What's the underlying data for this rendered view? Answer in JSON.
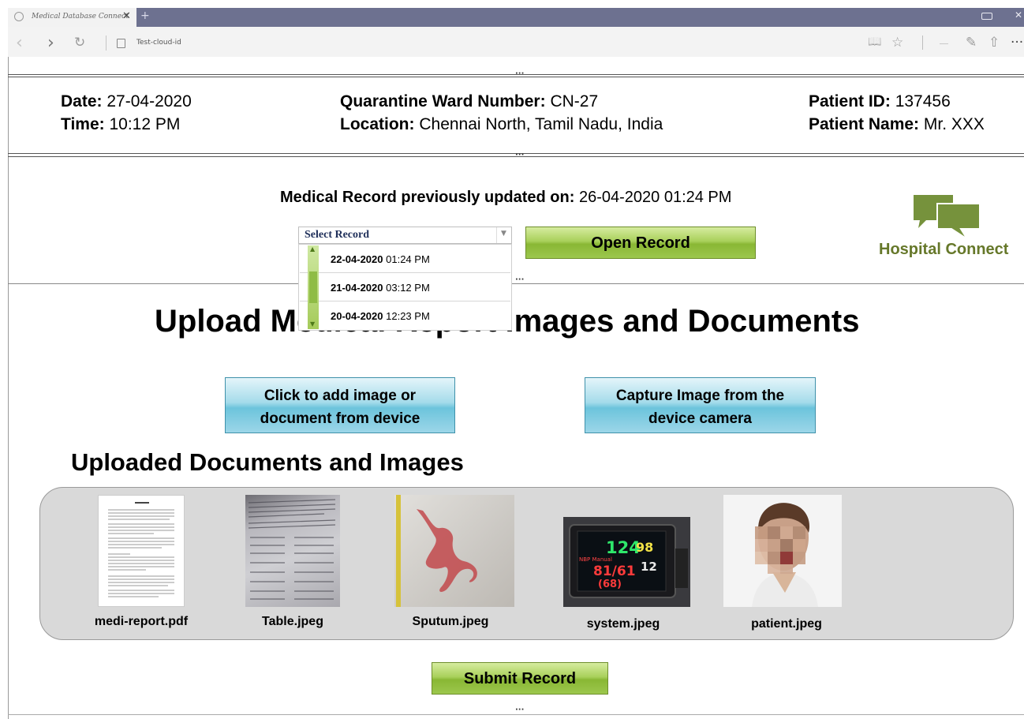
{
  "browser": {
    "tab_title": "Medical Database Connect",
    "tab_close": "✕",
    "new_tab": "+",
    "url": "Test-cloud-id",
    "window_close": "✕"
  },
  "toolbar": {
    "back": "‹",
    "forward": "›",
    "refresh": "↻",
    "reading_view": "📖",
    "favorite": "☆",
    "notes": "✎",
    "share": "⇧",
    "more": "···"
  },
  "panel_separator": "···",
  "header": {
    "date_label": "Date:",
    "date": "27-04-2020",
    "time_label": "Time:",
    "time": "10:12 PM",
    "ward_label": "Quarantine Ward Number:",
    "ward": "CN-27",
    "location_label": "Location:",
    "location": "Chennai North, Tamil Nadu, India",
    "patient_id_label": "Patient ID:",
    "patient_id": "137456",
    "patient_name_label": "Patient Name:",
    "patient_name": "Mr. XXX"
  },
  "record": {
    "previously_updated_label": "Medical Record previously updated on:",
    "previously_updated": "26-04-2020 01:24 PM",
    "select_value": "Select Record",
    "options": [
      {
        "date": "22-04-2020",
        "time": "01:24 PM"
      },
      {
        "date": "21-04-2020",
        "time": "03:12 PM"
      },
      {
        "date": "20-04-2020",
        "time": "12:23 PM"
      }
    ],
    "open_button": "Open Record"
  },
  "brand": {
    "name": "Hospital Connect",
    "color": "#66782a"
  },
  "upload": {
    "title": "Upload Medical Report Images and Documents",
    "add_from_device_line1": "Click to add image or",
    "add_from_device_line2": "document from device",
    "capture_line1": "Capture Image from the",
    "capture_line2": "device camera"
  },
  "uploaded": {
    "title": "Uploaded Documents and Images",
    "files": [
      {
        "name": "medi-report.pdf"
      },
      {
        "name": "Table.jpeg"
      },
      {
        "name": "Sputum.jpeg"
      },
      {
        "name": "system.jpeg",
        "monitor": {
          "hr": "124",
          "spo2": "98",
          "bp_label": "NBP Manual",
          "bp": "81/61",
          "map": "(68)",
          "rr": "12"
        }
      },
      {
        "name": "patient.jpeg"
      }
    ]
  },
  "submit_button": "Submit Record",
  "colors": {
    "green_button": "#a9d05b",
    "blue_button": "#8ccfe3",
    "gallery_bg": "#d9d9d9"
  }
}
